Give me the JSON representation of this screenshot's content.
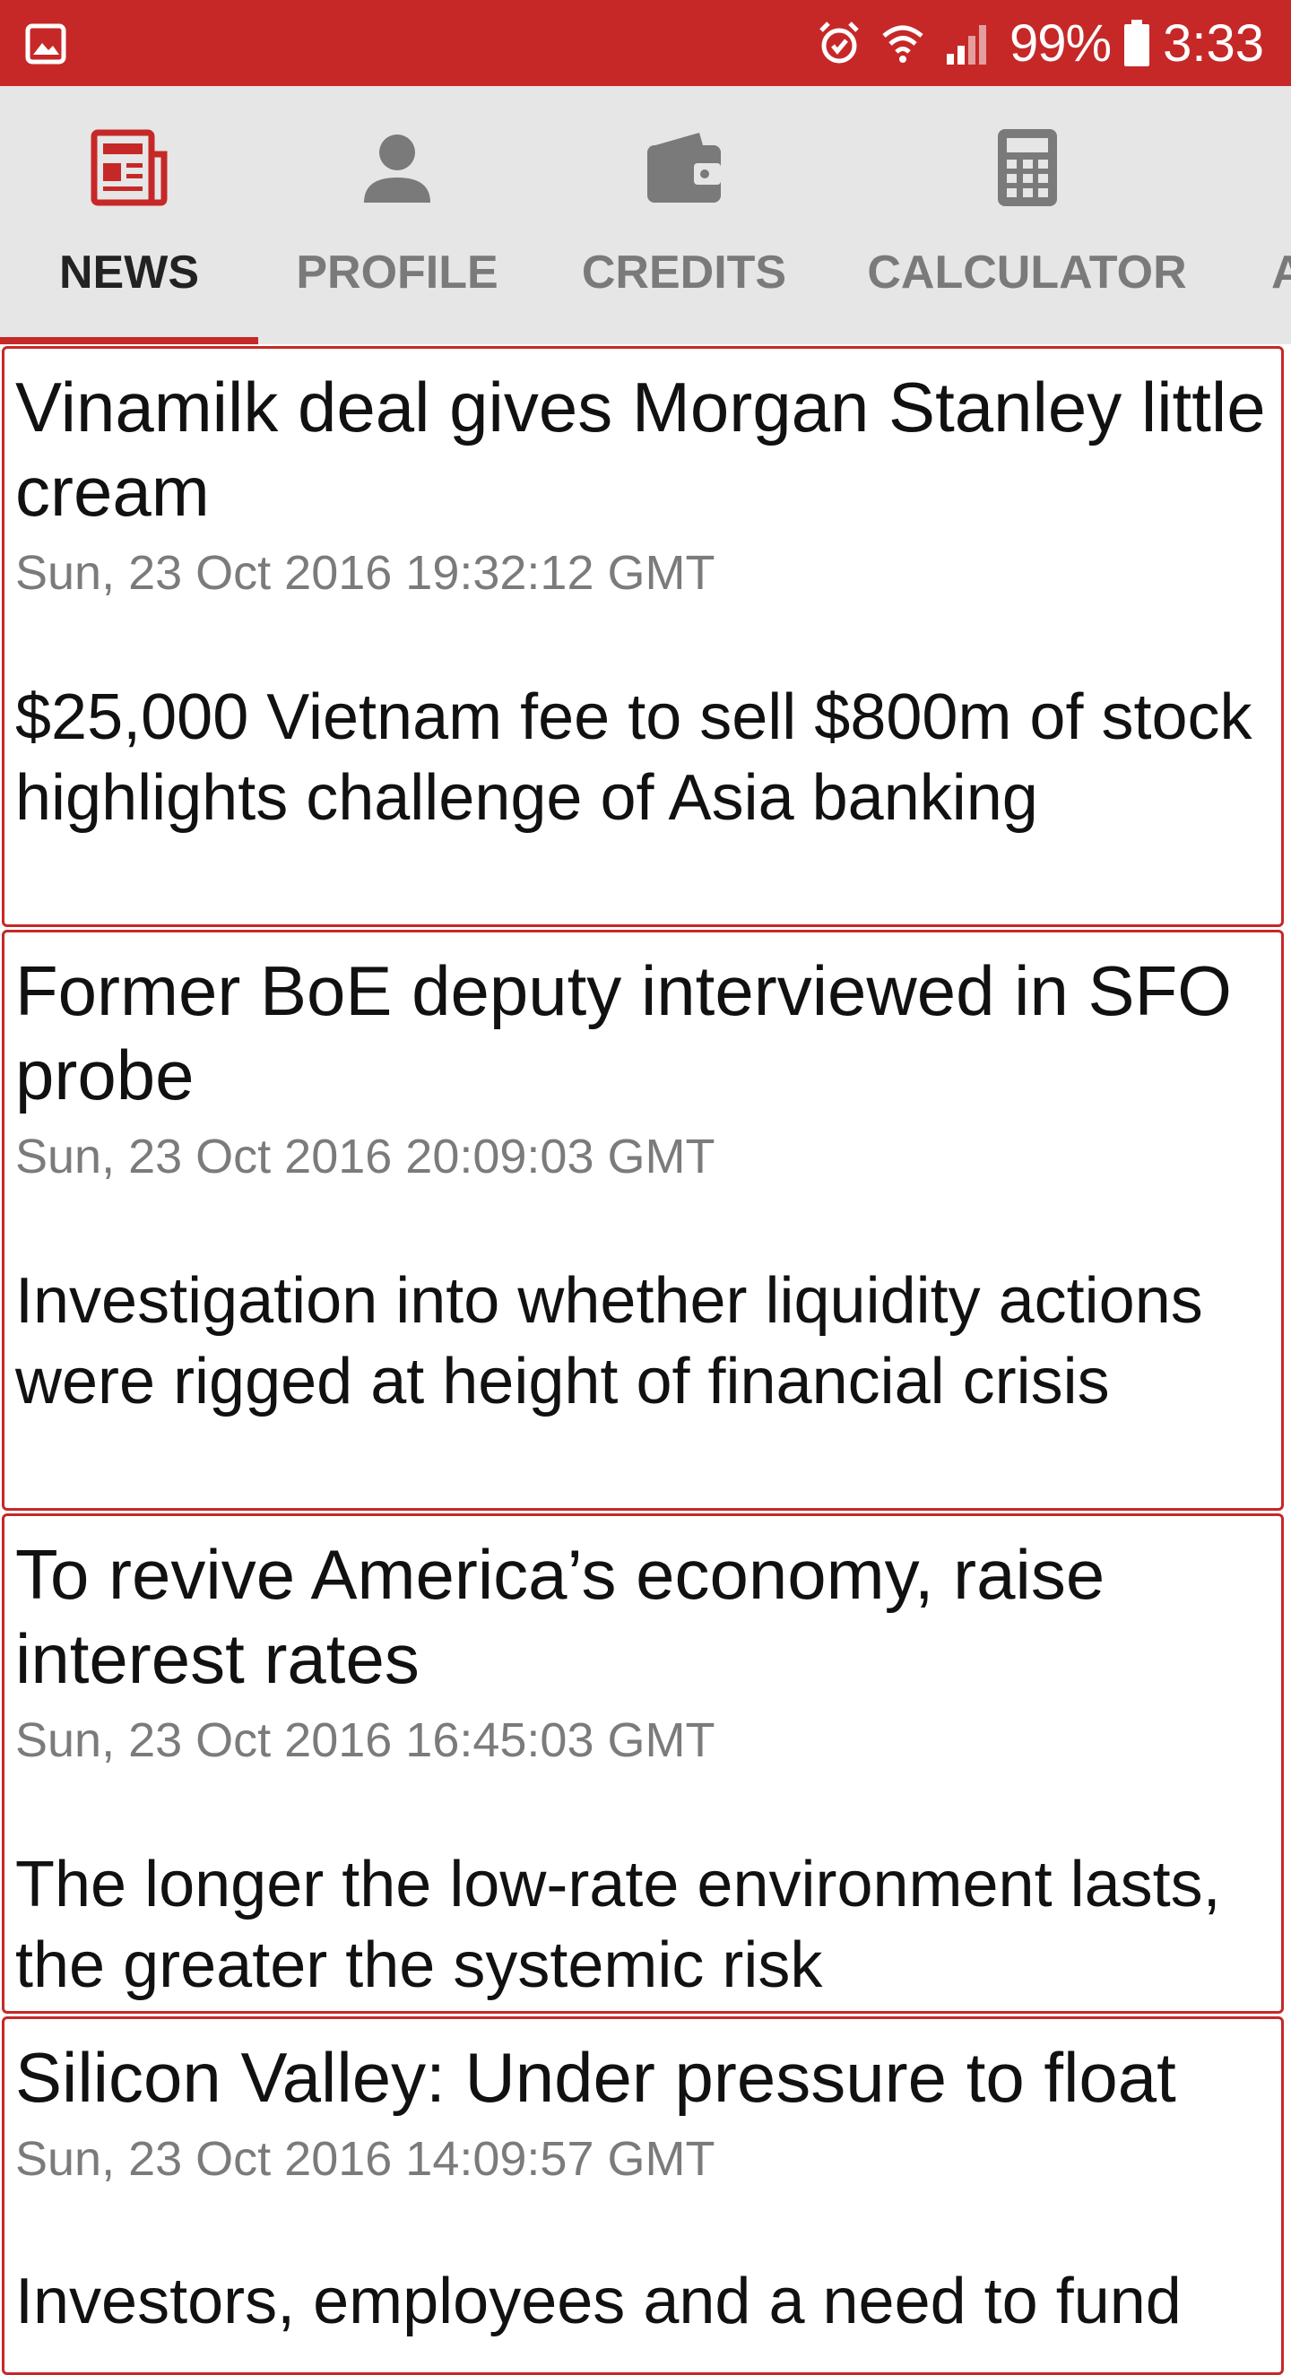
{
  "status_bar": {
    "battery_percent": "99%",
    "time": "3:33",
    "icons": [
      "gallery-icon",
      "alarm-icon",
      "wifi-icon",
      "cell-signal-icon",
      "battery-icon"
    ]
  },
  "tabs": [
    {
      "label": "NEWS",
      "icon": "news-icon",
      "active": true
    },
    {
      "label": "PROFILE",
      "icon": "person-icon",
      "active": false
    },
    {
      "label": "CREDITS",
      "icon": "wallet-icon",
      "active": false
    },
    {
      "label": "CALCULATOR",
      "icon": "calculator-icon",
      "active": false
    },
    {
      "label": "A",
      "icon": "",
      "active": false
    }
  ],
  "colors": {
    "accent": "#c62828",
    "tab_bar_bg": "#e6e6e6",
    "inactive_tab": "#7a7a7a",
    "date_text": "#7b7b7b"
  },
  "articles": [
    {
      "title": "Vinamilk deal gives Morgan Stanley little cream",
      "date": "Sun, 23 Oct 2016 19:32:12 GMT",
      "description": "$25,000 Vietnam fee to sell $800m of stock highlights challenge of Asia banking"
    },
    {
      "title": "Former BoE deputy interviewed in SFO probe",
      "date": "Sun, 23 Oct 2016 20:09:03 GMT",
      "description": "Investigation into whether liquidity actions were rigged at height of financial crisis"
    },
    {
      "title": "To revive America’s economy, raise interest rates",
      "date": "Sun, 23 Oct 2016 16:45:03 GMT",
      "description": "The longer the low-rate environment lasts, the greater the systemic risk"
    },
    {
      "title": "Silicon Valley: Under pressure to float",
      "date": "Sun, 23 Oct 2016 14:09:57 GMT",
      "description": "Investors, employees and a need to fund"
    }
  ]
}
